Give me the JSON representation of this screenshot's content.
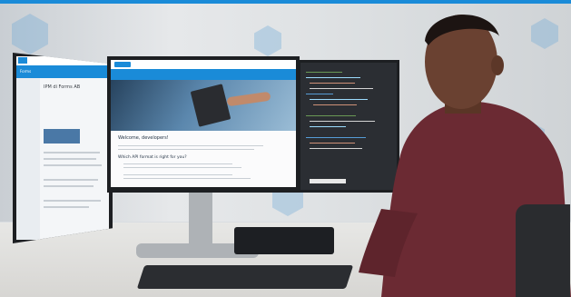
{
  "left_screen": {
    "nav_title": "Forms",
    "heading": "IPM di Forms AB"
  },
  "center_screen": {
    "welcome_heading": "Welcome, developers!",
    "section_heading": "Which API format is right for you?"
  },
  "colors": {
    "accent": "#1a8bd8",
    "shirt": "#6b2a33",
    "skin": "#6a4131",
    "hex": "#6eaad7"
  }
}
